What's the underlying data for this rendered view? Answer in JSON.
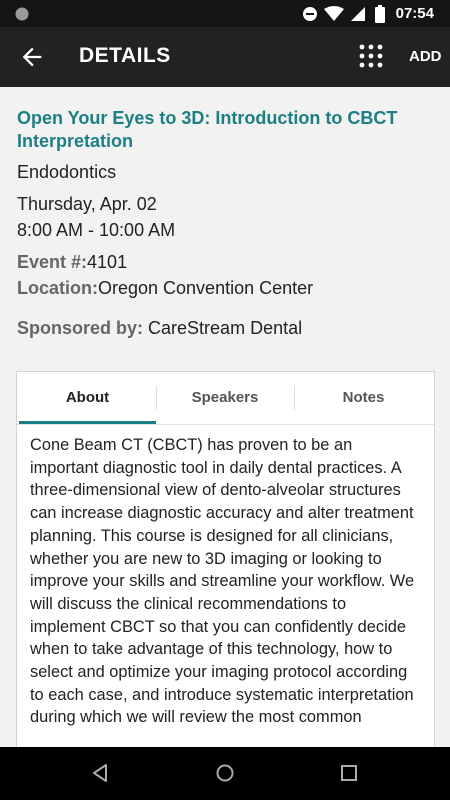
{
  "status": {
    "time": "07:54"
  },
  "appbar": {
    "title": "DETAILS",
    "add_label": "ADD"
  },
  "event": {
    "title": "Open Your Eyes to 3D: Introduction to CBCT Interpretation",
    "category": "Endodontics",
    "date": "Thursday, Apr. 02",
    "time": "8:00 AM - 10:00 AM",
    "number_label": "Event #:",
    "number": "4101",
    "location_label": "Location:",
    "location": "Oregon Convention Center",
    "sponsor_label": "Sponsored by:",
    "sponsor": "CareStream Dental"
  },
  "tabs": [
    {
      "label": "About"
    },
    {
      "label": "Speakers"
    },
    {
      "label": "Notes"
    }
  ],
  "about_text": "Cone Beam CT (CBCT) has proven to be an important diagnostic tool in daily dental practices. A three-dimensional view of dento-alveolar structures can increase diagnostic accuracy and alter treatment planning. This course is designed for all clinicians, whether you are new to 3D imaging or looking to improve your skills and streamline your workflow. We will discuss the clinical recommendations to implement CBCT so that you can confidently decide when to take advantage of this technology, how to select and optimize your imaging protocol according to each case, and introduce systematic interpretation during which we will review the most common",
  "colors": {
    "accent": "#1c7f86",
    "appbar": "#222222",
    "statusbar": "#151515"
  },
  "icons": [
    "back-arrow-icon",
    "grid-menu-icon",
    "dnd-icon",
    "wifi-icon",
    "cell-signal-icon",
    "battery-icon",
    "nav-back-icon",
    "nav-home-icon",
    "nav-recents-icon"
  ]
}
